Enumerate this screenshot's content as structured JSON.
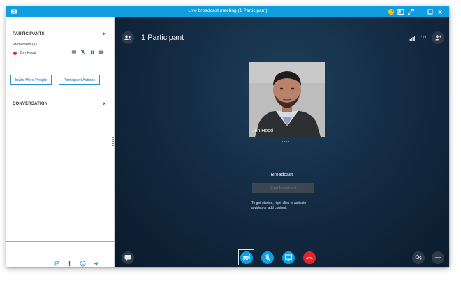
{
  "window": {
    "title": "Live broadcast meeting (1 Participant)"
  },
  "participants_panel": {
    "title": "PARTICIPANTS",
    "presenters_label": "Presenters (1)",
    "participant_name": "Jon Hood",
    "invite_button": "Invite More People",
    "actions_button": "Participant Actions"
  },
  "conversation_panel": {
    "title": "CONVERSATION"
  },
  "stage": {
    "participant_count": "1 Participant",
    "timer": "1:27",
    "presenter_name": "Jon Hood",
    "broadcast_label": "Broadcast",
    "start_button": "Start Broadcast",
    "hint_line1": "To get started, right-click to activate",
    "hint_line2": "a video or add content."
  },
  "colors": {
    "titlebar": "#0f9ee0",
    "accent": "#2b8fd1",
    "stage_bg": "#142c44",
    "hangup": "#e0242d",
    "status_busy": "#e0202a"
  },
  "icons": [
    "skype-icon",
    "emoji-icon",
    "layout-icon",
    "fullscreen-icon",
    "minimize-icon",
    "maximize-icon",
    "close-icon",
    "participants-icon",
    "signal-icon",
    "add-person-icon",
    "chat-icon",
    "mic-muted-icon",
    "pause-icon",
    "video-icon",
    "present-icon",
    "hangup-icon",
    "attachment-icon",
    "priority-icon",
    "smiley-icon",
    "send-icon",
    "more-icon",
    "devices-icon"
  ]
}
